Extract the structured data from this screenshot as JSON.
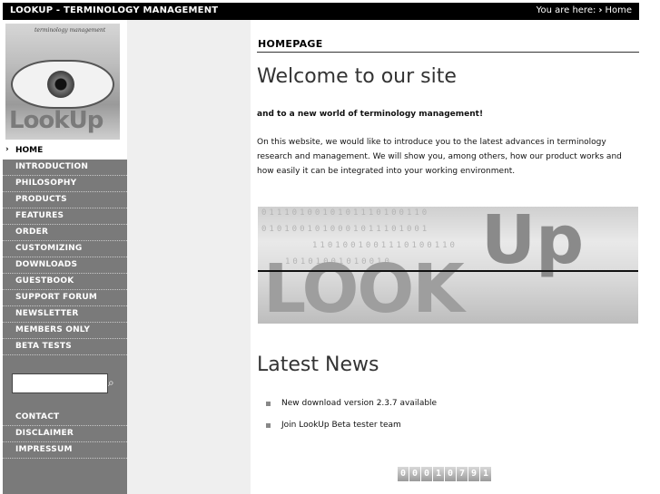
{
  "topbar": {
    "title": "LOOKUP - TERMINOLOGY MANAGEMENT",
    "you_are_here": "You are here:",
    "current": "Home"
  },
  "logo": {
    "tagline": "terminology management",
    "word": "LookUp"
  },
  "sidebar": {
    "home_label": "HOME",
    "items": [
      {
        "label": "INTRODUCTION"
      },
      {
        "label": "PHILOSOPHY"
      },
      {
        "label": "PRODUCTS"
      },
      {
        "label": "FEATURES"
      },
      {
        "label": "ORDER"
      },
      {
        "label": "CUSTOMIZING"
      },
      {
        "label": "DOWNLOADS"
      },
      {
        "label": "GUESTBOOK"
      },
      {
        "label": "SUPPORT FORUM"
      },
      {
        "label": "NEWSLETTER"
      },
      {
        "label": "MEMBERS ONLY"
      },
      {
        "label": "BETA TESTS"
      }
    ],
    "search": {
      "value": "",
      "icon": "search-icon"
    },
    "footer_items": [
      {
        "label": "CONTACT"
      },
      {
        "label": "DISCLAIMER"
      },
      {
        "label": "IMPRESSUM"
      }
    ]
  },
  "main": {
    "page_heading": "HOMEPAGE",
    "welcome": "Welcome to our site",
    "subhead": "and to a new world of terminology management!",
    "intro": "On this website, we would like to introduce you to the latest advances in terminology research and management. We will show you, among others, how our product works and how easily it can be integrated into your working environment.",
    "banner": {
      "word": "LOOK",
      "word2": "Up",
      "binary": [
        "0111010010101110100110",
        "0101001010001011101001",
        "1101001001110100110",
        "10101001010010"
      ]
    },
    "news_title": "Latest News",
    "news": [
      {
        "text": "New download version 2.3.7 available"
      },
      {
        "text": "Join LookUp Beta tester team"
      }
    ],
    "counter": [
      "0",
      "0",
      "0",
      "1",
      "0",
      "7",
      "9",
      "1"
    ]
  }
}
